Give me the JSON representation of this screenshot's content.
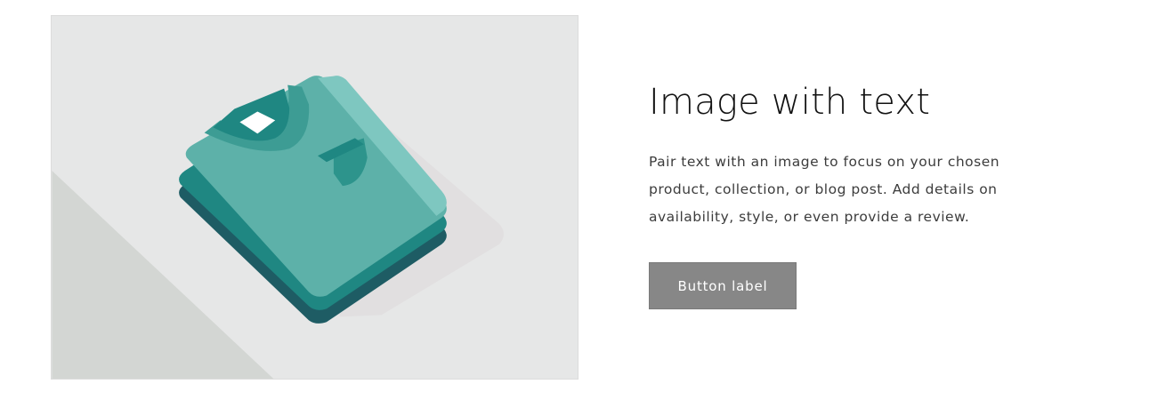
{
  "image_with_text": {
    "heading": "Image with text",
    "body": "Pair text with an image to focus on your chosen product, collection, or blog post. Add details on availability, style, or even provide a review.",
    "button_label": "Button label"
  },
  "colors": {
    "image_background": "#e6e7e7",
    "image_shadow": "#d3d6d3",
    "shirt_light": "#5db1a9",
    "shirt_mid": "#1f8782",
    "shirt_dark": "#1e5c64",
    "button_bg": "#878787",
    "heading_text": "#121212",
    "body_text": "#3c3c3c"
  },
  "media": {
    "icon": "folded-shirts-illustration"
  }
}
